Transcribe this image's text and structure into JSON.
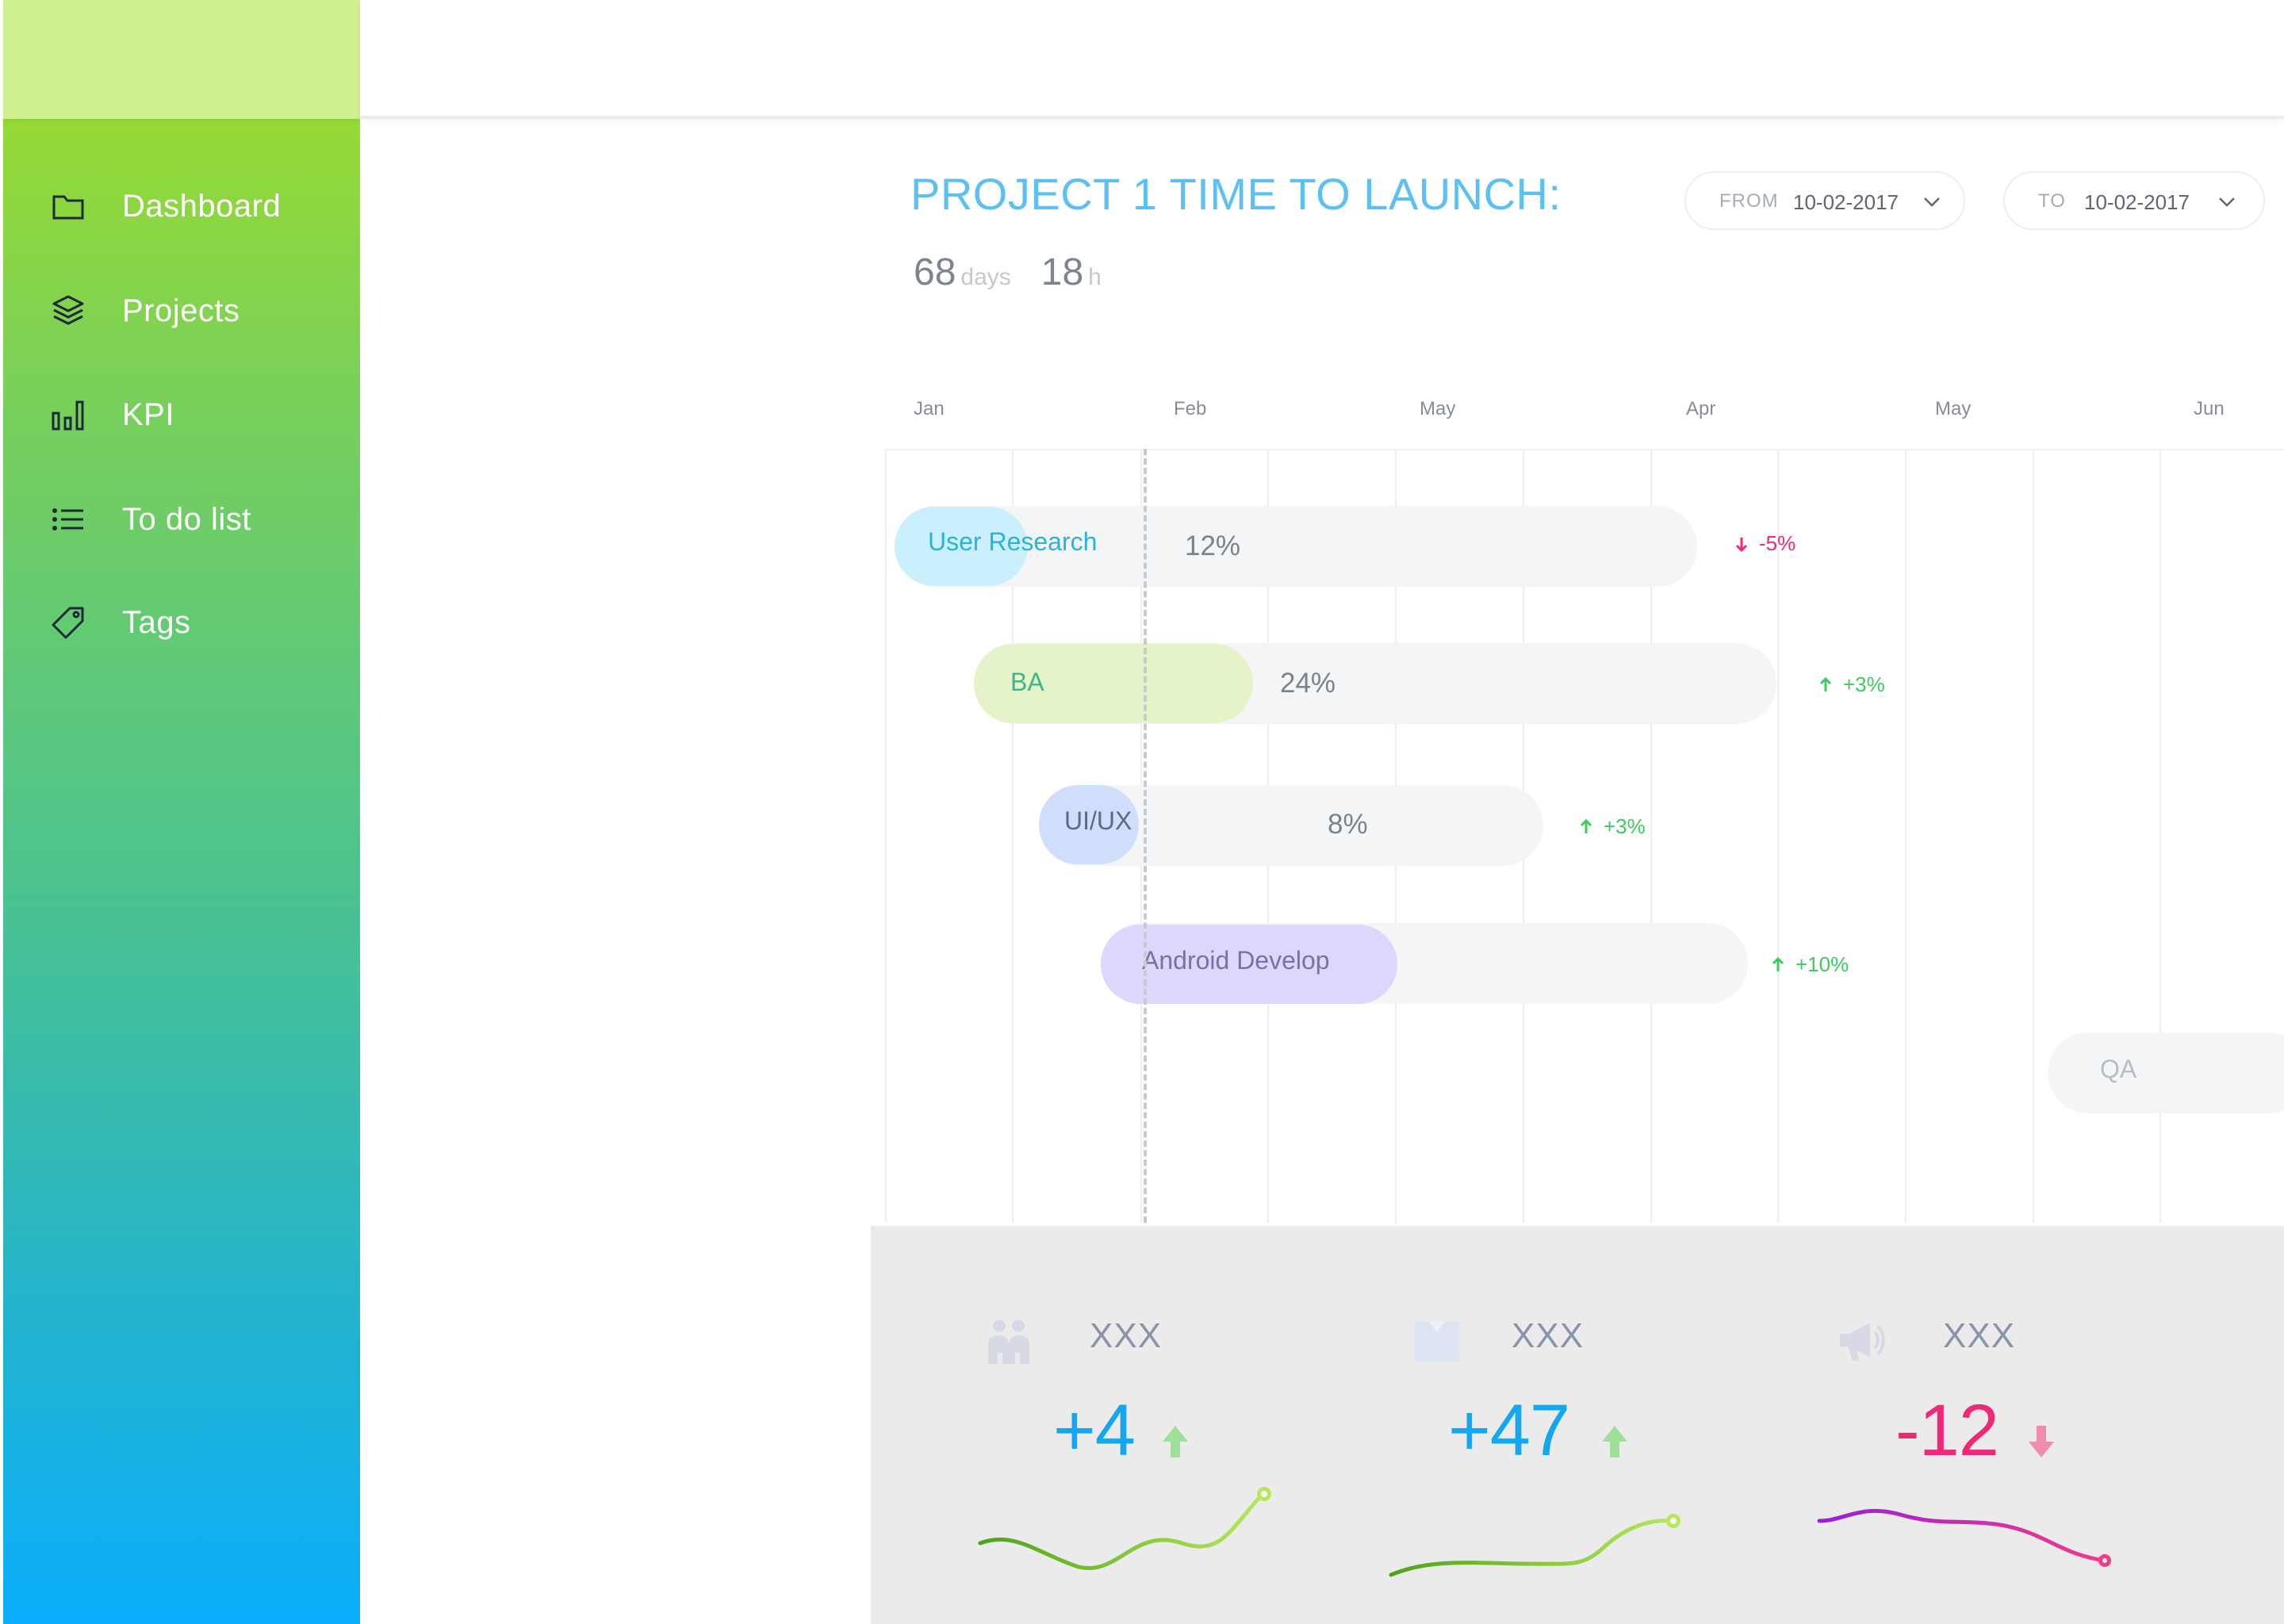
{
  "sidebar": {
    "items": [
      {
        "label": "Dashboard",
        "icon": "folder-icon"
      },
      {
        "label": "Projects",
        "icon": "layers-icon"
      },
      {
        "label": "KPI",
        "icon": "bar-chart-icon"
      },
      {
        "label": "To do list",
        "icon": "list-icon"
      },
      {
        "label": "Tags",
        "icon": "tag-icon"
      }
    ]
  },
  "header": {
    "title": "PROJECT 1 TIME TO LAUNCH:",
    "countdown": {
      "days": "68",
      "days_unit": "days",
      "hours": "18",
      "hours_unit": "h"
    },
    "from": {
      "label": "FROM",
      "value": "10-02-2017"
    },
    "to": {
      "label": "TO",
      "value": "10-02-2017"
    }
  },
  "gantt": {
    "months": [
      "Jan",
      "Feb",
      "May",
      "Apr",
      "May",
      "Jun"
    ],
    "tasks": [
      {
        "name": "User Research",
        "percent": 12,
        "percent_label": "12%",
        "delta": "-5%",
        "trend": "down"
      },
      {
        "name": "BA",
        "percent": 24,
        "percent_label": "24%",
        "delta": "+3%",
        "trend": "up"
      },
      {
        "name": "UI/UX",
        "percent": 8,
        "percent_label": "8%",
        "delta": "+3%",
        "trend": "up"
      },
      {
        "name": "Android Develop",
        "percent": null,
        "percent_label": "",
        "delta": "+10%",
        "trend": "up"
      },
      {
        "name": "QA",
        "percent": null,
        "percent_label": "",
        "delta": "",
        "trend": ""
      }
    ]
  },
  "stats": [
    {
      "label": "XXX",
      "value": "+4",
      "trend": "up",
      "icon": "people-icon",
      "color": "#12a7ee"
    },
    {
      "label": "XXX",
      "value": "+47",
      "trend": "up",
      "icon": "shirt-icon",
      "color": "#12a7ee"
    },
    {
      "label": "XXX",
      "value": "-12",
      "trend": "down",
      "icon": "megaphone-icon",
      "color": "#ee2a78"
    }
  ],
  "colors": {
    "accent": "#5cc1f2",
    "positive": "#3ccb5c",
    "negative": "#ee2a78",
    "sidebar_top": "#95d936",
    "sidebar_bottom": "#0aaefc"
  }
}
